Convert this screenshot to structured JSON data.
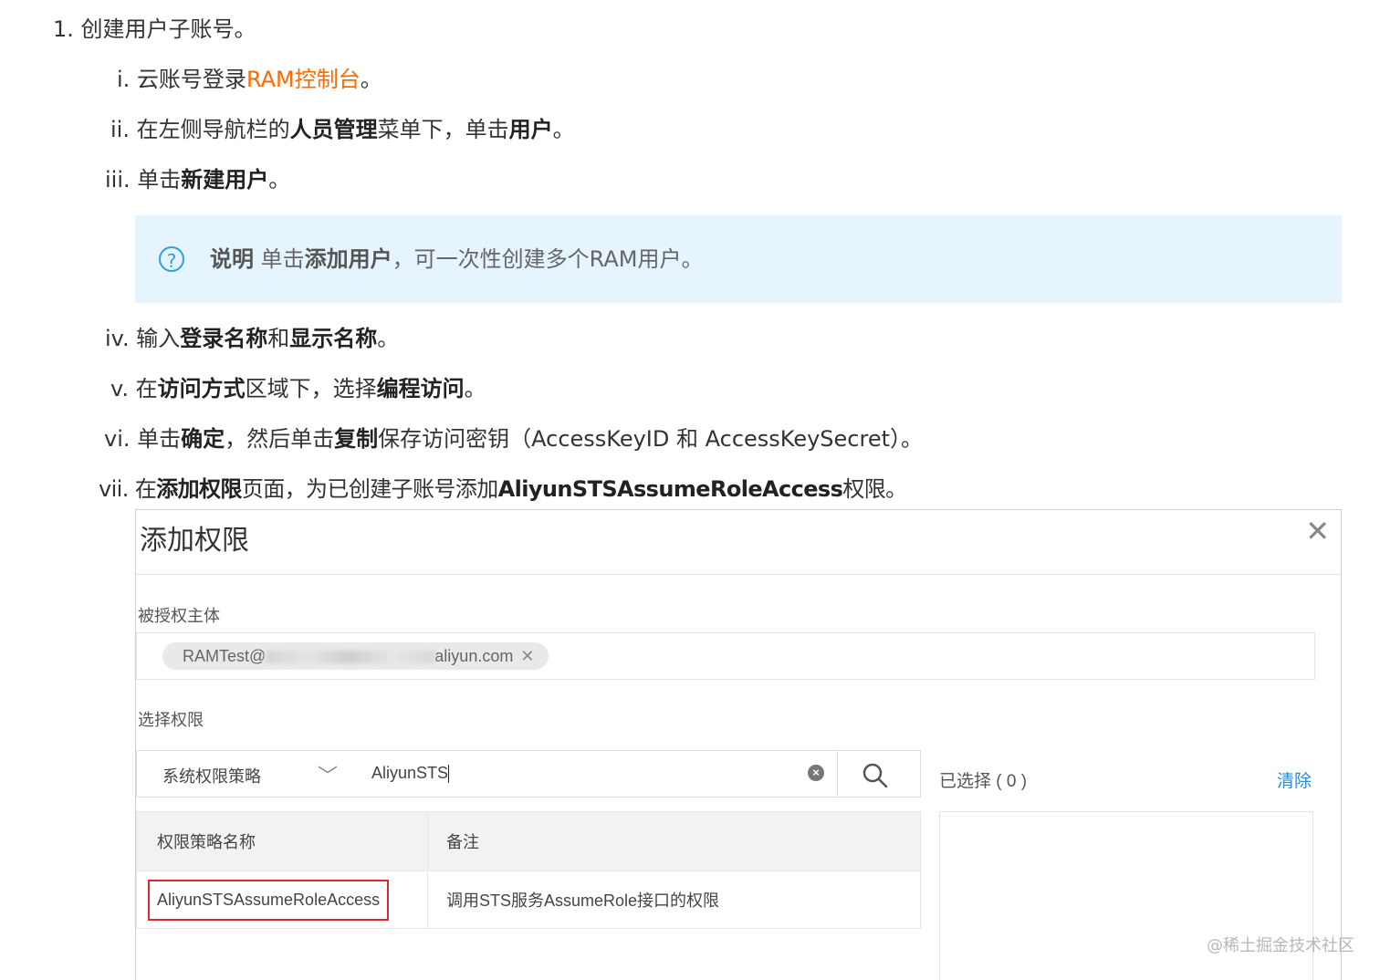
{
  "steps": [
    {
      "num": "1.",
      "parts": [
        {
          "t": "创建用户子账号。",
          "s": "n"
        }
      ]
    },
    {
      "num": "i.",
      "parts": [
        {
          "t": "云账号登录",
          "s": "n"
        },
        {
          "t": "RAM控制台",
          "s": "link"
        },
        {
          "t": "。",
          "s": "n"
        }
      ]
    },
    {
      "num": "ii.",
      "parts": [
        {
          "t": "在左侧导航栏的",
          "s": "n"
        },
        {
          "t": "人员管理",
          "s": "b"
        },
        {
          "t": "菜单下，单击",
          "s": "n"
        },
        {
          "t": "用户",
          "s": "b"
        },
        {
          "t": "。",
          "s": "n"
        }
      ]
    },
    {
      "num": "iii.",
      "parts": [
        {
          "t": "单击",
          "s": "n"
        },
        {
          "t": "新建用户",
          "s": "b"
        },
        {
          "t": "。",
          "s": "n"
        }
      ]
    },
    {
      "num": "iv.",
      "parts": [
        {
          "t": "输入",
          "s": "n"
        },
        {
          "t": "登录名称",
          "s": "b"
        },
        {
          "t": "和",
          "s": "n"
        },
        {
          "t": "显示名称",
          "s": "b"
        },
        {
          "t": "。",
          "s": "n"
        }
      ]
    },
    {
      "num": "v.",
      "parts": [
        {
          "t": "在",
          "s": "n"
        },
        {
          "t": "访问方式",
          "s": "b"
        },
        {
          "t": "区域下，选择",
          "s": "n"
        },
        {
          "t": "编程访问",
          "s": "b"
        },
        {
          "t": "。",
          "s": "n"
        }
      ]
    },
    {
      "num": "vi.",
      "parts": [
        {
          "t": "单击",
          "s": "n"
        },
        {
          "t": "确定",
          "s": "b"
        },
        {
          "t": "，然后单击",
          "s": "n"
        },
        {
          "t": "复制",
          "s": "b"
        },
        {
          "t": "保存访问密钥（AccessKeyID 和 AccessKeySecret）。",
          "s": "n"
        }
      ]
    },
    {
      "num": "vii.",
      "parts": [
        {
          "t": "在",
          "s": "n"
        },
        {
          "t": "添加权限",
          "s": "b"
        },
        {
          "t": "页面，为已创建子账号添加",
          "s": "n"
        },
        {
          "t": "AliyunSTSAssumeRoleAccess",
          "s": "b"
        },
        {
          "t": "权限。",
          "s": "n"
        }
      ]
    }
  ],
  "note": {
    "icon": "question-circle-icon",
    "label": "说明",
    "text_1": " 单击",
    "bold": "添加用户",
    "text_2": "，可一次性创建多个RAM用户。"
  },
  "dialog": {
    "title": "添加权限",
    "close": "✕",
    "principal_label": "被授权主体",
    "principal_prefix": "RAMTest@",
    "principal_suffix": "aliyun.com",
    "chip_remove": "✕",
    "select_label": "选择权限",
    "policy_type": "系统权限策略",
    "search_value": "AliyunSTS",
    "selected_label": "已选择 ( 0 )",
    "clear_label": "清除",
    "table": {
      "headers": [
        "权限策略名称",
        "备注"
      ],
      "rows": [
        [
          "AliyunSTSAssumeRoleAccess",
          "调用STS服务AssumeRole接口的权限"
        ]
      ]
    }
  },
  "watermark": "@稀土掘金技术社区"
}
